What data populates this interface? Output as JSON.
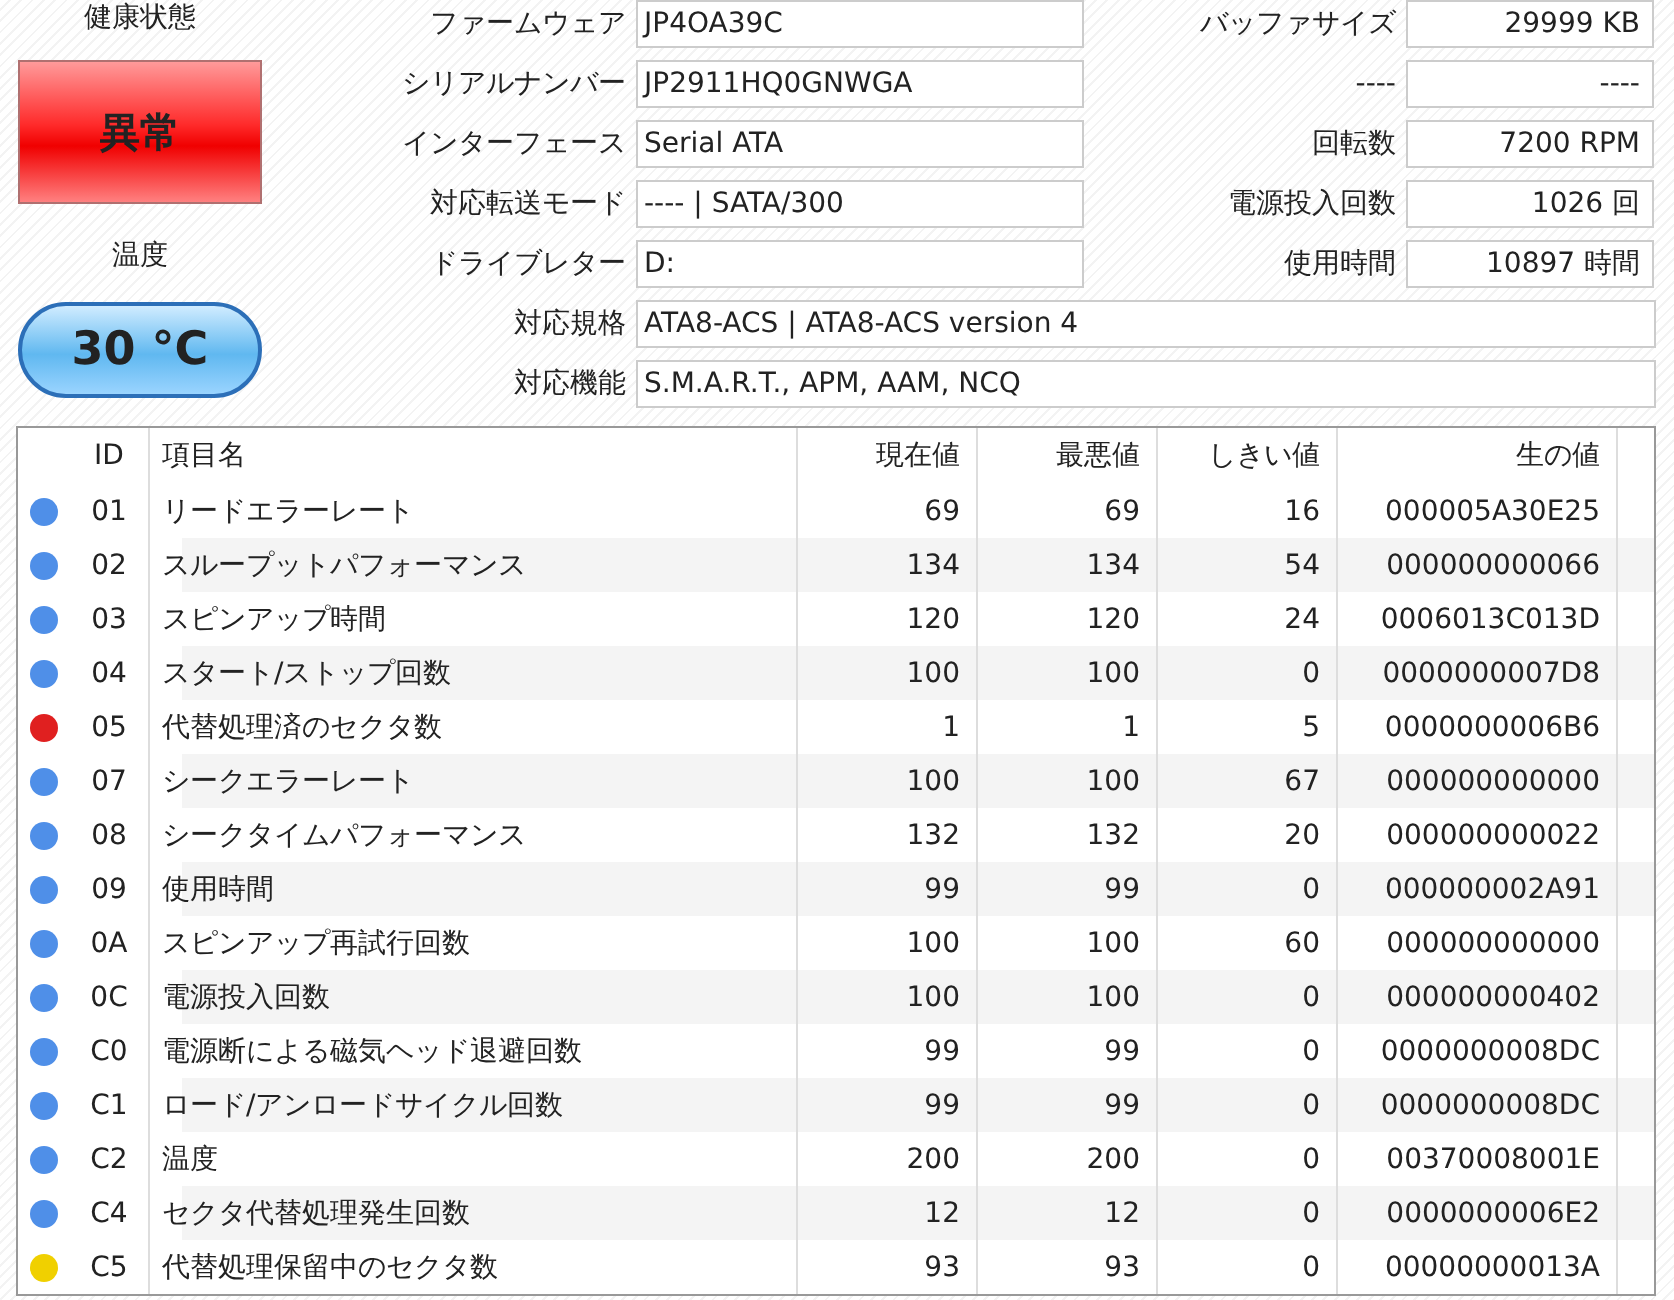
{
  "health": {
    "label": "健康状態",
    "status": "異常",
    "alert": true
  },
  "temperature": {
    "label": "温度",
    "value": "30 °C"
  },
  "info_rows": [
    {
      "label": "ファームウェア",
      "value": "JP4OA39C",
      "right_label": "バッファサイズ",
      "right_value": "29999 KB"
    },
    {
      "label": "シリアルナンバー",
      "value": "JP2911HQ0GNWGA",
      "right_label": "----",
      "right_value": "----"
    },
    {
      "label": "インターフェース",
      "value": "Serial ATA",
      "right_label": "回転数",
      "right_value": "7200 RPM"
    },
    {
      "label": "対応転送モード",
      "value": "---- | SATA/300",
      "right_label": "電源投入回数",
      "right_value": "1026 回"
    },
    {
      "label": "ドライブレター",
      "value": "D:",
      "right_label": "使用時間",
      "right_value": "10897 時間"
    },
    {
      "label": "対応規格",
      "value": "ATA8-ACS | ATA8-ACS version 4"
    },
    {
      "label": "対応機能",
      "value": "S.M.A.R.T., APM, AAM, NCQ"
    }
  ],
  "table": {
    "columns": [
      "ID",
      "項目名",
      "現在値",
      "最悪値",
      "しきい値",
      "生の値"
    ],
    "rows": [
      {
        "color": "#4f8fe8",
        "id": "01",
        "name": "リードエラーレート",
        "current": "69",
        "worst": "69",
        "threshold": "16",
        "raw": "000005A30E25"
      },
      {
        "color": "#4f8fe8",
        "id": "02",
        "name": "スループットパフォーマンス",
        "current": "134",
        "worst": "134",
        "threshold": "54",
        "raw": "000000000066"
      },
      {
        "color": "#4f8fe8",
        "id": "03",
        "name": "スピンアップ時間",
        "current": "120",
        "worst": "120",
        "threshold": "24",
        "raw": "0006013C013D"
      },
      {
        "color": "#4f8fe8",
        "id": "04",
        "name": "スタート/ストップ回数",
        "current": "100",
        "worst": "100",
        "threshold": "0",
        "raw": "0000000007D8"
      },
      {
        "color": "#e02020",
        "id": "05",
        "name": "代替処理済のセクタ数",
        "current": "1",
        "worst": "1",
        "threshold": "5",
        "raw": "0000000006B6"
      },
      {
        "color": "#4f8fe8",
        "id": "07",
        "name": "シークエラーレート",
        "current": "100",
        "worst": "100",
        "threshold": "67",
        "raw": "000000000000"
      },
      {
        "color": "#4f8fe8",
        "id": "08",
        "name": "シークタイムパフォーマンス",
        "current": "132",
        "worst": "132",
        "threshold": "20",
        "raw": "000000000022"
      },
      {
        "color": "#4f8fe8",
        "id": "09",
        "name": "使用時間",
        "current": "99",
        "worst": "99",
        "threshold": "0",
        "raw": "000000002A91"
      },
      {
        "color": "#4f8fe8",
        "id": "0A",
        "name": "スピンアップ再試行回数",
        "current": "100",
        "worst": "100",
        "threshold": "60",
        "raw": "000000000000"
      },
      {
        "color": "#4f8fe8",
        "id": "0C",
        "name": "電源投入回数",
        "current": "100",
        "worst": "100",
        "threshold": "0",
        "raw": "000000000402"
      },
      {
        "color": "#4f8fe8",
        "id": "C0",
        "name": "電源断による磁気ヘッド退避回数",
        "current": "99",
        "worst": "99",
        "threshold": "0",
        "raw": "0000000008DC"
      },
      {
        "color": "#4f8fe8",
        "id": "C1",
        "name": "ロード/アンロードサイクル回数",
        "current": "99",
        "worst": "99",
        "threshold": "0",
        "raw": "0000000008DC"
      },
      {
        "color": "#4f8fe8",
        "id": "C2",
        "name": "温度",
        "current": "200",
        "worst": "200",
        "threshold": "0",
        "raw": "00370008001E"
      },
      {
        "color": "#4f8fe8",
        "id": "C4",
        "name": "セクタ代替処理発生回数",
        "current": "12",
        "worst": "12",
        "threshold": "0",
        "raw": "0000000006E2"
      },
      {
        "color": "#f0d000",
        "id": "C5",
        "name": "代替処理保留中のセクタ数",
        "current": "93",
        "worst": "93",
        "threshold": "0",
        "raw": "00000000013A"
      }
    ]
  }
}
